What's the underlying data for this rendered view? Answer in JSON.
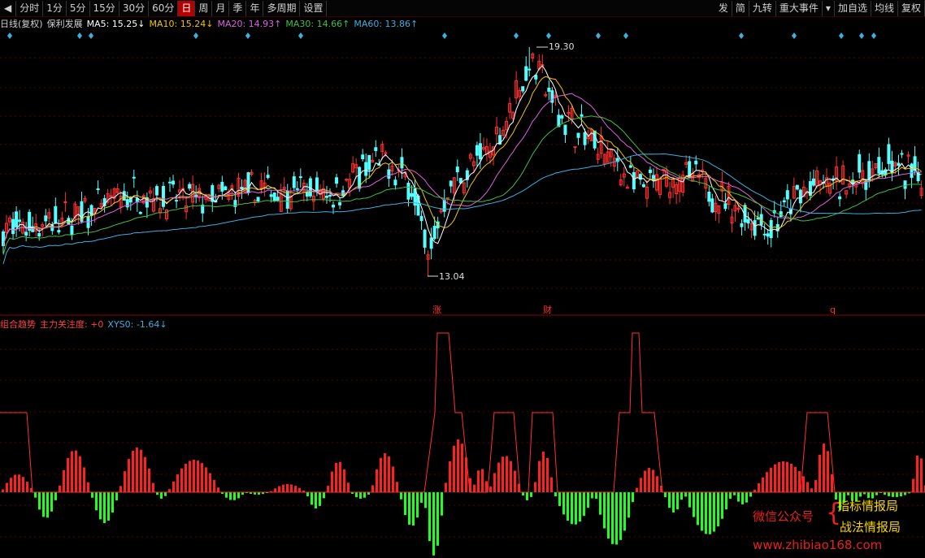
{
  "toolbar": {
    "left_buttons": [
      "分时",
      "1分",
      "5分",
      "15分",
      "30分",
      "60分",
      "日",
      "周",
      "月",
      "季",
      "年",
      "多周期",
      "设置"
    ],
    "active": "日",
    "right_buttons": [
      "发",
      "简",
      "九转",
      "重大事件",
      "▾",
      "加自选",
      "均线",
      "复权"
    ]
  },
  "legend": {
    "period": "日线(复权)",
    "stock_name": "保利发展",
    "ma5": "MA5: 15.25↓",
    "ma10": "MA10: 15.24↓",
    "ma20": "MA20: 14.93↑",
    "ma30": "MA30: 14.66↑",
    "ma60": "MA60: 13.86↑"
  },
  "colors": {
    "ma5": "#ffffff",
    "ma10": "#f0c400",
    "ma20": "#e060e0",
    "ma30": "#40c040",
    "ma60": "#3ab0e0",
    "up": "#ff3030",
    "down": "#54ffff",
    "grid": "#5a0000",
    "hist_up": "#ff2020",
    "hist_down": "#20ff20",
    "signal_line": "#ff3030"
  },
  "annotations": {
    "high_price": "19.30",
    "low_price": "13.04",
    "marker_1": "涨",
    "marker_2": "财",
    "marker_3": "q"
  },
  "sub_legend": {
    "name": "组合趋势",
    "item1": "主力关注度: +0",
    "item2": "XYS0: -1.64↓"
  },
  "watermark": {
    "line1": "微信公众号",
    "line2": "指标情报局",
    "line3": "战法情报局",
    "line4": "www.zhibiao168.com"
  },
  "chart_data": {
    "type": "candlestick",
    "price_range": [
      13.04,
      19.3
    ],
    "highlight_high": 19.3,
    "highlight_low": 13.04,
    "moving_averages": [
      "MA5",
      "MA10",
      "MA20",
      "MA30",
      "MA60"
    ],
    "subchart": {
      "type": "bar",
      "name": "组合趋势",
      "series": [
        "主力关注度",
        "XYS0"
      ]
    }
  }
}
